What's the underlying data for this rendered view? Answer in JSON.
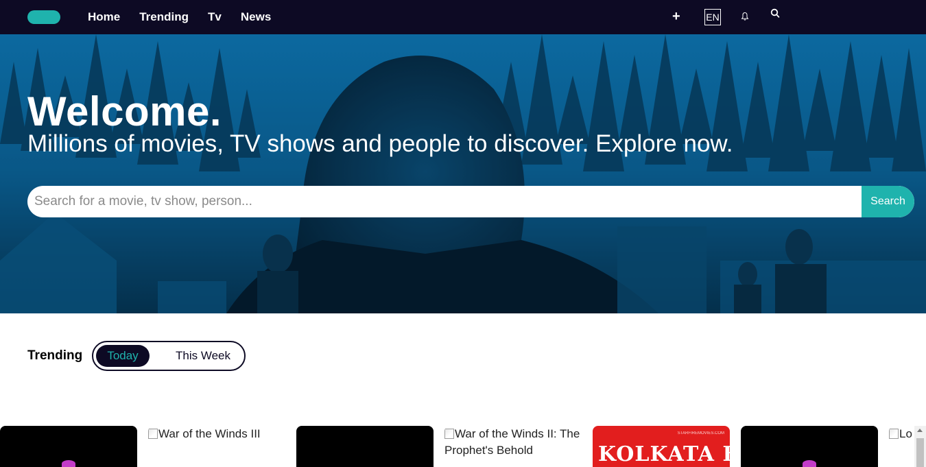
{
  "nav": {
    "links": [
      "Home",
      "Trending",
      "Tv",
      "News"
    ],
    "plus_label": "+",
    "language": "EN",
    "icons": [
      "plus-icon",
      "bell-icon",
      "search-icon"
    ]
  },
  "hero": {
    "title": "Welcome.",
    "subtitle": "Millions of movies, TV shows and people to discover. Explore now.",
    "search_placeholder": "Search for a movie, tv show, person...",
    "search_button": "Search"
  },
  "trending": {
    "label": "Trending",
    "options": [
      "Today",
      "This Week"
    ],
    "selected": "Today"
  },
  "cards": [
    {
      "alt": ""
    },
    {
      "alt": "War of the Winds III"
    },
    {
      "alt": ""
    },
    {
      "alt": "War of the Winds II: The Prophet's Behold"
    },
    {
      "alt": "",
      "title": "KOLKATA B KING"
    },
    {
      "alt": ""
    },
    {
      "alt": "Lo"
    }
  ],
  "colors": {
    "navbar": "#0d0a24",
    "accent": "#1fb3ad",
    "hero_tint": "#0a6ea8"
  }
}
